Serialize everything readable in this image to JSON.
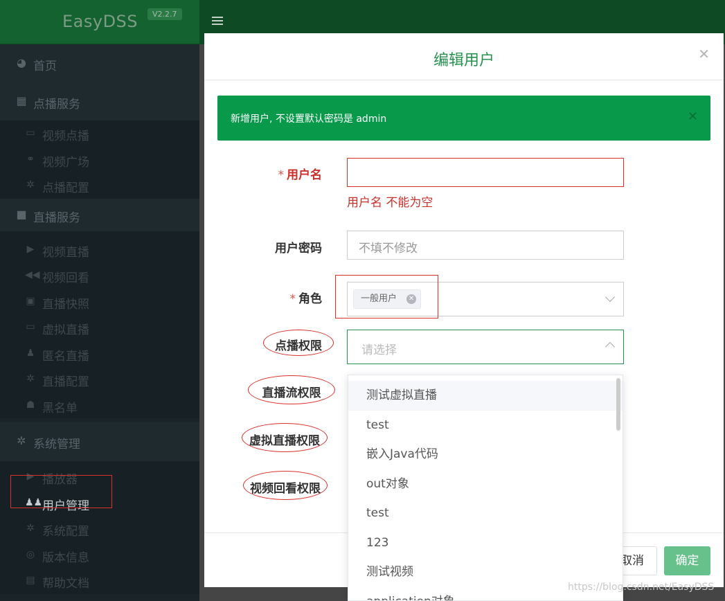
{
  "brand": {
    "name": "EasyDSS",
    "version": "V2.2.7"
  },
  "sidebar": {
    "groups": [
      {
        "label": "首页",
        "icon": "dashboard-icon",
        "items": []
      },
      {
        "label": "点播服务",
        "icon": "film-icon",
        "items": [
          {
            "label": "视频点播",
            "icon": "monitor-icon"
          },
          {
            "label": "视频广场",
            "icon": "binoculars-icon"
          },
          {
            "label": "点播配置",
            "icon": "gear-icon"
          }
        ]
      },
      {
        "label": "直播服务",
        "icon": "video-camera-icon",
        "items": [
          {
            "label": "视频直播",
            "icon": "play-square-icon"
          },
          {
            "label": "视频回看",
            "icon": "backward-icon"
          },
          {
            "label": "直播快照",
            "icon": "image-icon"
          },
          {
            "label": "虚拟直播",
            "icon": "laptop-icon"
          },
          {
            "label": "匿名直播",
            "icon": "user-secret-icon"
          },
          {
            "label": "直播配置",
            "icon": "gear-icon"
          },
          {
            "label": "黑名单",
            "icon": "ghost-icon"
          }
        ]
      },
      {
        "label": "系统管理",
        "icon": "gears-icon",
        "items": [
          {
            "label": "播放器",
            "icon": "play-circle-icon"
          },
          {
            "label": "用户管理",
            "icon": "users-icon",
            "active": true
          },
          {
            "label": "系统配置",
            "icon": "gear-icon"
          },
          {
            "label": "版本信息",
            "icon": "life-ring-icon"
          },
          {
            "label": "帮助文档",
            "icon": "book-icon"
          }
        ]
      }
    ]
  },
  "modal": {
    "title": "编辑用户",
    "alert": "新增用户, 不设置默认密码是 admin",
    "fields": {
      "username": {
        "label": "用户名",
        "value": "",
        "error": "用户名 不能为空"
      },
      "password": {
        "label": "用户密码",
        "placeholder": "不填不修改"
      },
      "role": {
        "label": "角色",
        "tag": "一般用户"
      },
      "vod_perm": {
        "label": "点播权限",
        "placeholder": "请选择"
      },
      "live_perm": {
        "label": "直播流权限"
      },
      "virtual_perm": {
        "label": "虚拟直播权限"
      },
      "playback_perm": {
        "label": "视频回看权限"
      }
    },
    "footer": {
      "cancel": "取消",
      "ok": "确定"
    }
  },
  "dropdown": {
    "options": [
      "测试虚拟直播",
      "test",
      "嵌入Java代码",
      "out对象",
      "test",
      "123",
      "测试视频",
      "application对象"
    ]
  },
  "watermark": "https://blog.csdn.net/EasyDSS",
  "colors": {
    "accent": "#26924d",
    "alert": "#08994b",
    "error": "#d9302a",
    "ok_button": "#67c18a"
  }
}
